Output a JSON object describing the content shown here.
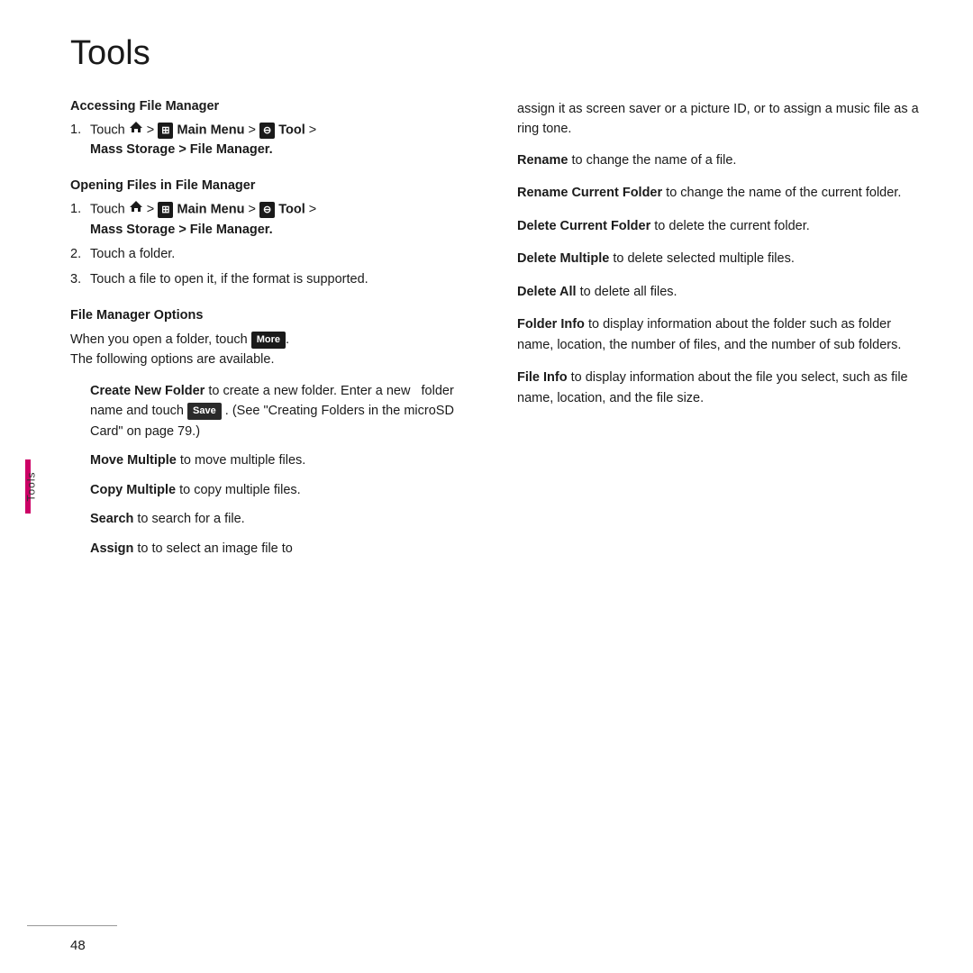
{
  "page": {
    "title": "Tools",
    "page_number": "48",
    "sidebar_label": "Tools"
  },
  "left_column": {
    "sections": [
      {
        "id": "accessing-file-manager",
        "heading": "Accessing File Manager",
        "steps": [
          {
            "num": "1.",
            "html_key": "step_home_menu_tool_mass_storage"
          }
        ]
      },
      {
        "id": "opening-files",
        "heading": "Opening Files in File Manager",
        "steps": [
          {
            "num": "1.",
            "html_key": "step_home_menu_tool_mass_storage"
          },
          {
            "num": "2.",
            "text": "Touch a folder."
          },
          {
            "num": "3.",
            "text": "Touch a file to open it, if the format is supported."
          }
        ]
      },
      {
        "id": "file-manager-options",
        "heading": "File Manager Options",
        "intro": "When you open a folder, touch [More]. The following options are available.",
        "options": [
          {
            "term": "Create New Folder",
            "desc": " to create a new folder. Enter a new   folder name and touch [Save] . (See \"Creating Folders in the microSD Card\" on page 79.)"
          },
          {
            "term": "Move Multiple",
            "desc": " to move multiple files."
          },
          {
            "term": "Copy Multiple",
            "desc": " to copy multiple files."
          },
          {
            "term": "Search",
            "desc": " to search for a file."
          },
          {
            "term": "Assign",
            "desc": " to to select an image file to"
          }
        ]
      }
    ]
  },
  "right_column": {
    "intro_text": "assign it as screen saver or a picture ID, or to assign a music file as a ring tone.",
    "options": [
      {
        "term": "Rename",
        "desc": " to change the name of a file."
      },
      {
        "term": "Rename Current Folder",
        "desc": " to change the name of the current folder."
      },
      {
        "term": "Delete Current Folder",
        "desc": " to delete the current folder."
      },
      {
        "term": "Delete Multiple",
        "desc": " to delete selected multiple files."
      },
      {
        "term": "Delete All",
        "desc": " to delete all files."
      },
      {
        "term": "Folder Info",
        "desc": " to display information about the folder such as folder name, location, the number of files, and the number of sub folders."
      },
      {
        "term": "File Info",
        "desc": " to display information about the file you select, such as file name, location, and the file size."
      }
    ]
  },
  "buttons": {
    "more_label": "More",
    "save_label": "Save"
  }
}
